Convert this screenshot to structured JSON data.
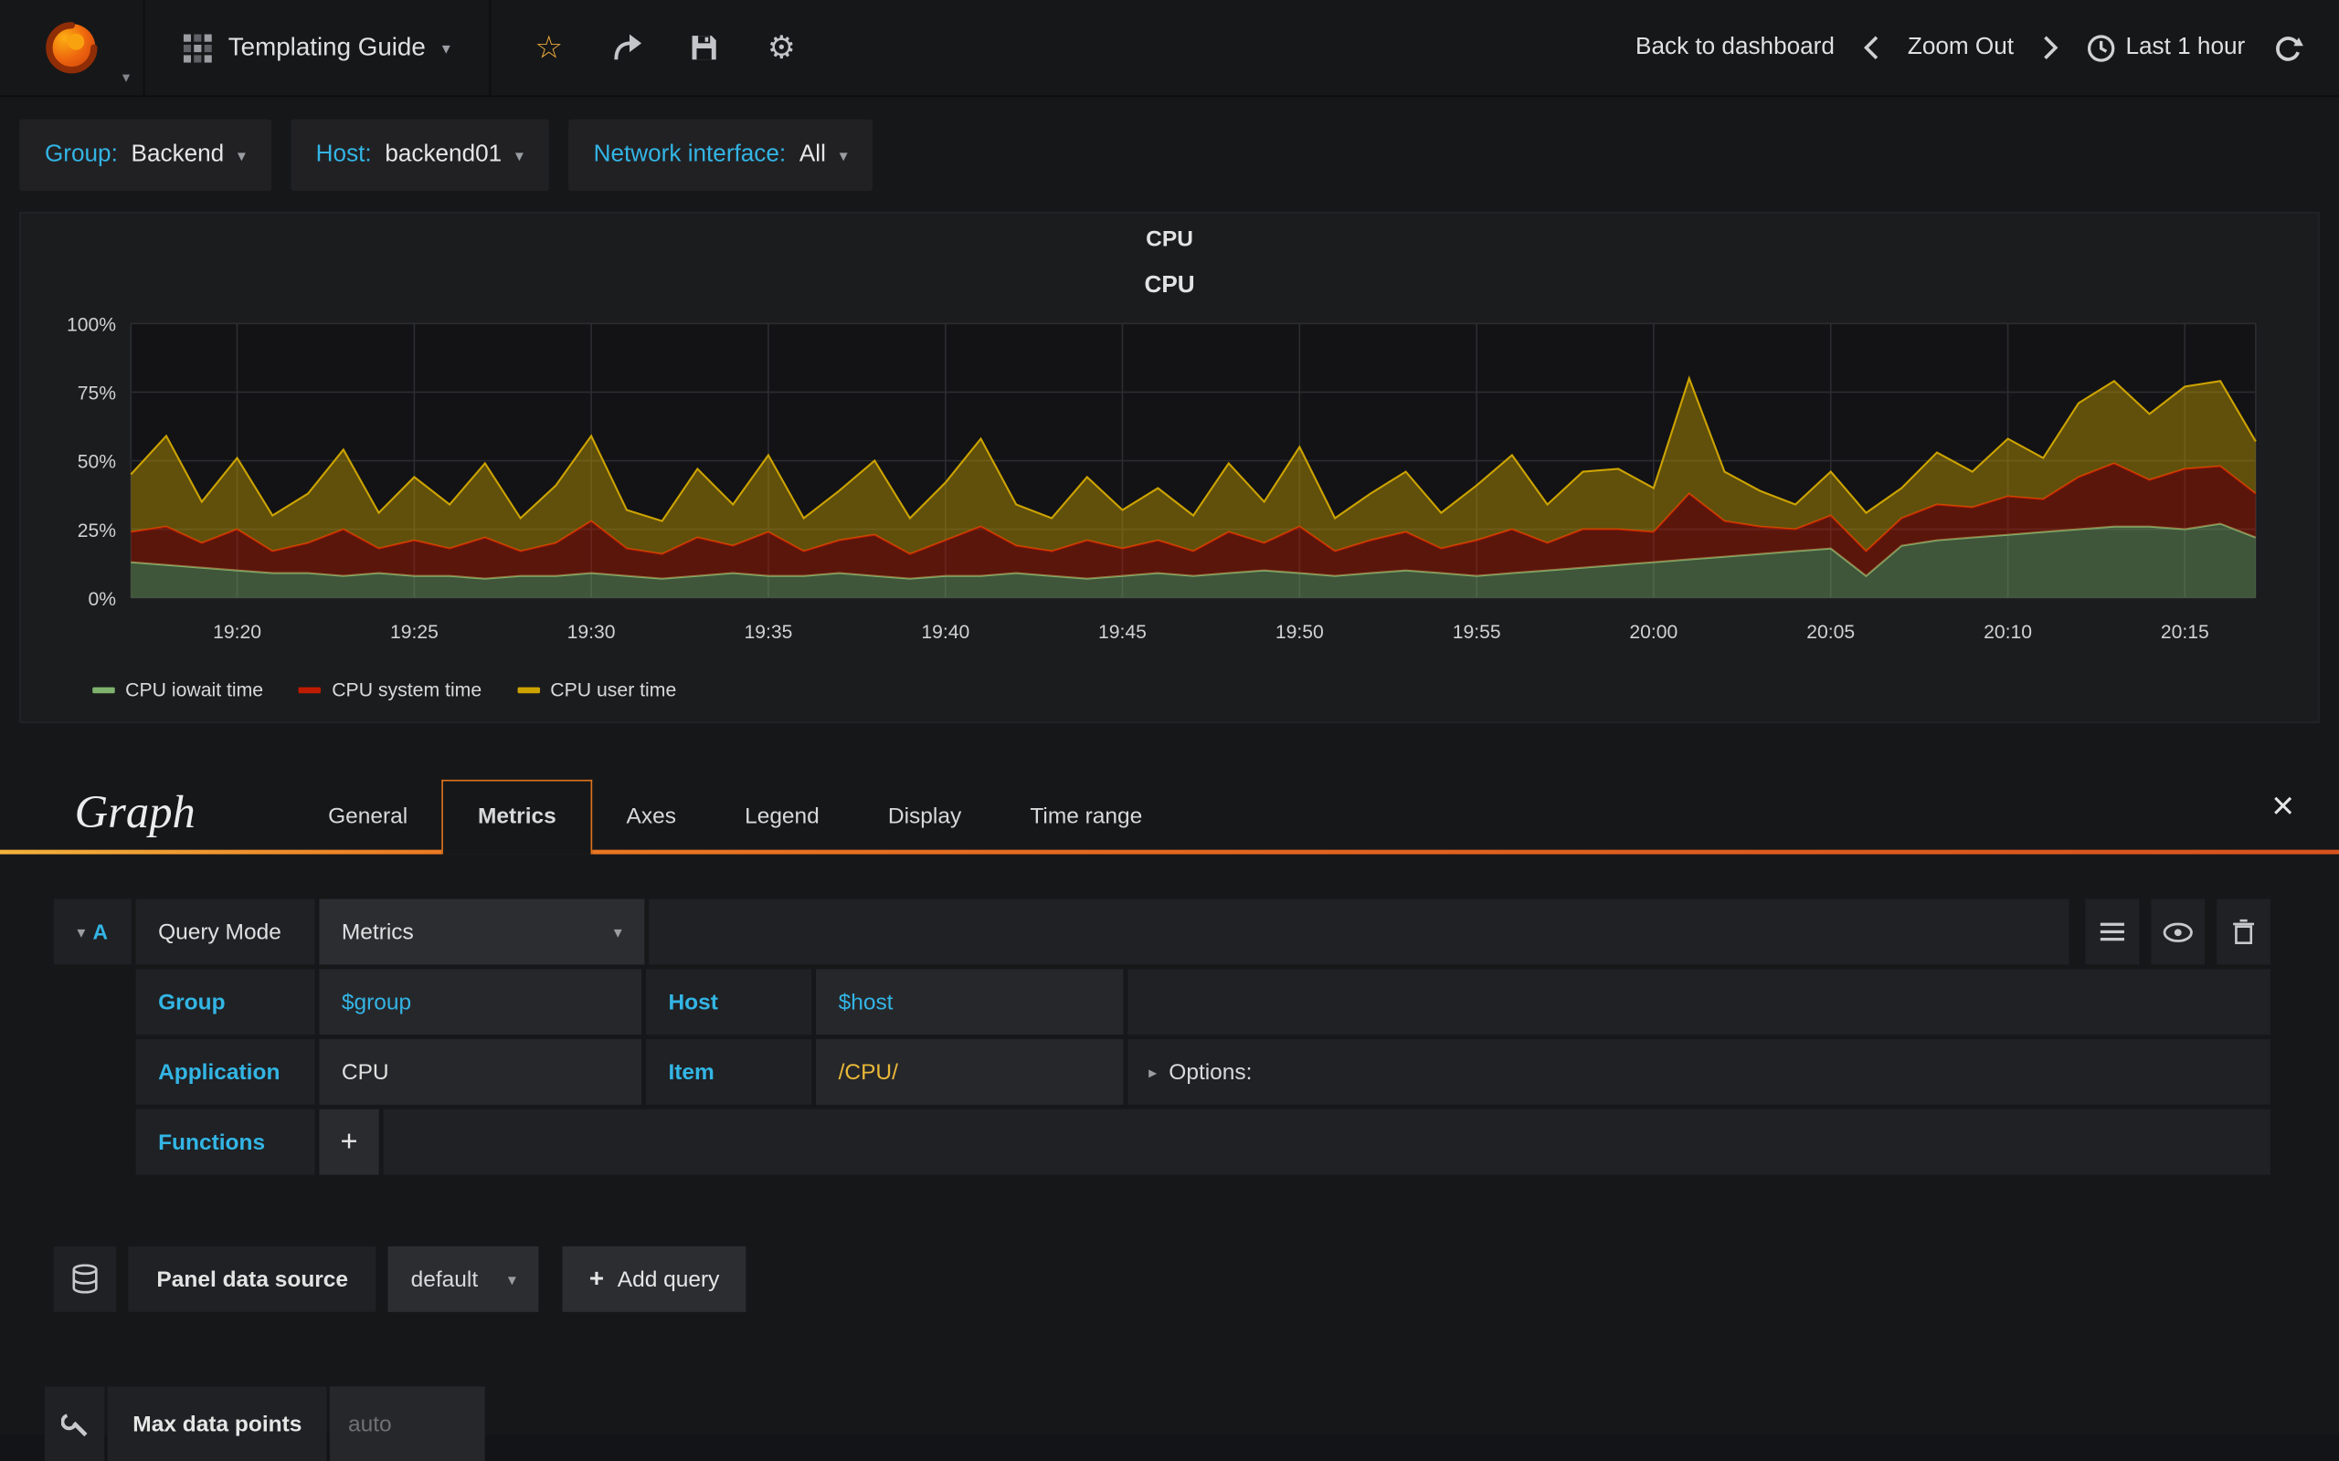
{
  "navbar": {
    "title": "Templating Guide",
    "back_label": "Back to dashboard",
    "zoom_out_label": "Zoom Out",
    "time_label": "Last 1 hour"
  },
  "icons": {
    "caret_down": "▾",
    "caret_right": "▸",
    "close": "×",
    "plus": "+",
    "star": "☆",
    "gear": "⚙"
  },
  "variables": [
    {
      "label": "Group:",
      "value": "Backend"
    },
    {
      "label": "Host:",
      "value": "backend01"
    },
    {
      "label": "Network interface:",
      "value": "All"
    }
  ],
  "panel": {
    "title": "CPU"
  },
  "chart_data": {
    "type": "area",
    "stacked": true,
    "title": "CPU",
    "xlabel": "",
    "ylabel": "",
    "ylim": [
      0,
      100
    ],
    "grid": true,
    "legend_position": "bottom-left",
    "x_unit": "minutes after 19:17 (time axis 19:17 - 20:17, Last 1 hour)",
    "x": [
      0,
      1,
      2,
      3,
      4,
      5,
      6,
      7,
      8,
      9,
      10,
      11,
      12,
      13,
      14,
      15,
      16,
      17,
      18,
      19,
      20,
      21,
      22,
      23,
      24,
      25,
      26,
      27,
      28,
      29,
      30,
      31,
      32,
      33,
      34,
      35,
      36,
      37,
      38,
      39,
      40,
      41,
      42,
      43,
      44,
      45,
      46,
      47,
      48,
      49,
      50,
      51,
      52,
      53,
      54,
      55,
      56,
      57,
      58,
      59,
      60
    ],
    "x_ticks": [
      {
        "t": 3,
        "label": "19:20"
      },
      {
        "t": 8,
        "label": "19:25"
      },
      {
        "t": 13,
        "label": "19:30"
      },
      {
        "t": 18,
        "label": "19:35"
      },
      {
        "t": 23,
        "label": "19:40"
      },
      {
        "t": 28,
        "label": "19:45"
      },
      {
        "t": 33,
        "label": "19:50"
      },
      {
        "t": 38,
        "label": "19:55"
      },
      {
        "t": 43,
        "label": "20:00"
      },
      {
        "t": 48,
        "label": "20:05"
      },
      {
        "t": 53,
        "label": "20:10"
      },
      {
        "t": 58,
        "label": "20:15"
      }
    ],
    "y_ticks": [
      {
        "v": 0,
        "label": "0%"
      },
      {
        "v": 25,
        "label": "25%"
      },
      {
        "v": 50,
        "label": "50%"
      },
      {
        "v": 75,
        "label": "75%"
      },
      {
        "v": 100,
        "label": "100%"
      }
    ],
    "series": [
      {
        "name": "CPU iowait time",
        "color": "#7eb26d",
        "values": [
          13,
          12,
          11,
          10,
          9,
          9,
          8,
          9,
          8,
          8,
          7,
          8,
          8,
          9,
          8,
          7,
          8,
          9,
          8,
          8,
          9,
          8,
          7,
          8,
          8,
          9,
          8,
          7,
          8,
          9,
          8,
          9,
          10,
          9,
          8,
          9,
          10,
          9,
          8,
          9,
          10,
          11,
          12,
          13,
          14,
          15,
          16,
          17,
          18,
          8,
          19,
          21,
          22,
          23,
          24,
          25,
          26,
          26,
          25,
          27,
          22
        ]
      },
      {
        "name": "CPU system time",
        "color": "#bf1b00",
        "values": [
          11,
          14,
          9,
          15,
          8,
          11,
          17,
          9,
          13,
          10,
          15,
          9,
          12,
          19,
          10,
          9,
          14,
          10,
          16,
          9,
          12,
          15,
          9,
          13,
          18,
          10,
          9,
          14,
          10,
          12,
          9,
          15,
          10,
          17,
          9,
          12,
          14,
          9,
          13,
          16,
          10,
          14,
          13,
          11,
          24,
          13,
          10,
          8,
          12,
          9,
          10,
          13,
          11,
          14,
          12,
          19,
          23,
          17,
          22,
          21,
          16
        ]
      },
      {
        "name": "CPU user time",
        "color": "#cca300",
        "values": [
          21,
          33,
          15,
          26,
          13,
          18,
          29,
          13,
          23,
          16,
          27,
          12,
          21,
          31,
          14,
          12,
          25,
          15,
          28,
          12,
          18,
          27,
          13,
          21,
          32,
          15,
          12,
          23,
          14,
          19,
          13,
          25,
          15,
          29,
          12,
          17,
          22,
          13,
          20,
          27,
          14,
          21,
          22,
          16,
          42,
          18,
          13,
          9,
          16,
          14,
          11,
          19,
          13,
          21,
          15,
          27,
          30,
          24,
          30,
          31,
          19
        ]
      }
    ]
  },
  "editor": {
    "title": "Graph",
    "tabs": [
      "General",
      "Metrics",
      "Axes",
      "Legend",
      "Display",
      "Time range"
    ],
    "active_tab": "Metrics",
    "query": {
      "ref": "A",
      "mode_label": "Query Mode",
      "mode_value": "Metrics",
      "group_label": "Group",
      "group_value": "$group",
      "host_label": "Host",
      "host_value": "$host",
      "app_label": "Application",
      "app_value": "CPU",
      "item_label": "Item",
      "item_value": "/CPU/",
      "functions_label": "Functions",
      "options_label": "Options:"
    },
    "datasource": {
      "label": "Panel data source",
      "value": "default",
      "add_query_label": "Add query"
    },
    "max_data_points": {
      "label": "Max data points",
      "placeholder": "auto"
    }
  }
}
